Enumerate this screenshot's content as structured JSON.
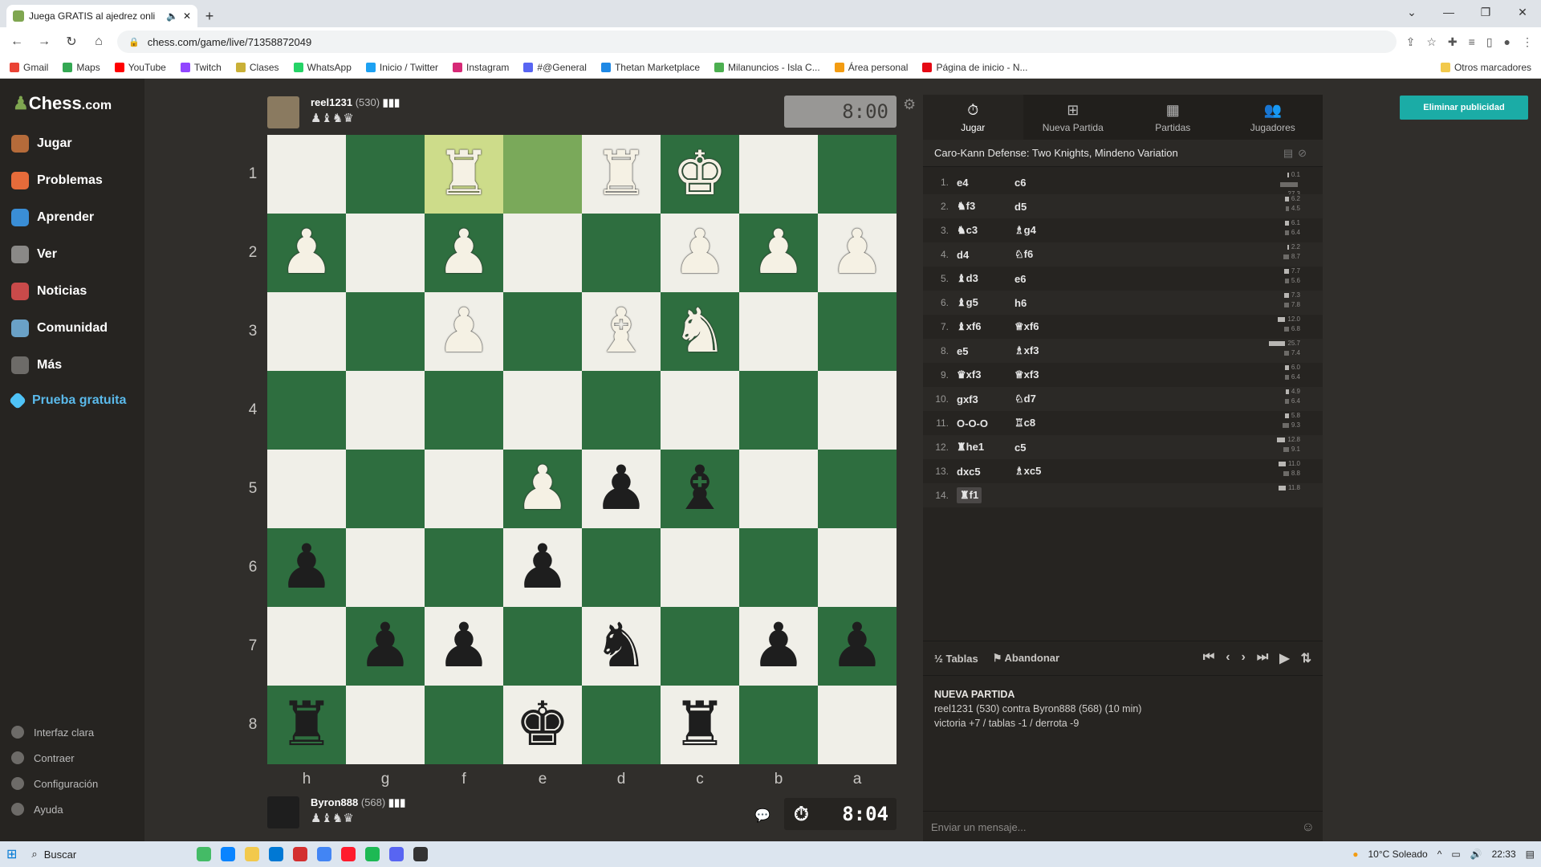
{
  "browser": {
    "tab_title": "Juega GRATIS al ajedrez onli",
    "url": "chess.com/game/live/71358872049",
    "bookmarks": [
      "Gmail",
      "Maps",
      "YouTube",
      "Twitch",
      "Clases",
      "WhatsApp",
      "Inicio / Twitter",
      "Instagram",
      "#@General",
      "Thetan Marketplace",
      "Milanuncios - Isla C...",
      "Área personal",
      "Página de inicio - N..."
    ],
    "bookmarks_other": "Otros marcadores"
  },
  "leftnav": {
    "logo": "Chess",
    "logo_suffix": ".com",
    "items": [
      "Jugar",
      "Problemas",
      "Aprender",
      "Ver",
      "Noticias",
      "Comunidad",
      "Más",
      "Prueba gratuita"
    ],
    "bottom": [
      "Interfaz clara",
      "Contraer",
      "Configuración",
      "Ayuda"
    ]
  },
  "top_player": {
    "name": "reel1231",
    "rating": "(530)",
    "captured": "♟♝♞♛",
    "clock": "8:00"
  },
  "bottom_player": {
    "name": "Byron888",
    "rating": "(568)",
    "captured": "♟♝♞♛",
    "clock": "8:04"
  },
  "board": {
    "ranks": [
      "1",
      "2",
      "3",
      "4",
      "5",
      "6",
      "7",
      "8"
    ],
    "files": [
      "h",
      "g",
      "f",
      "e",
      "d",
      "c",
      "b",
      "a"
    ],
    "rows": [
      [
        "",
        "",
        "wR",
        "",
        "wR",
        "wK",
        "",
        ""
      ],
      [
        "wP",
        "",
        "wP",
        "",
        "",
        "wP",
        "wP",
        "wP"
      ],
      [
        "",
        "",
        "wP",
        "",
        "wB",
        "wN",
        "",
        ""
      ],
      [
        "",
        "",
        "",
        "",
        "",
        "",
        "",
        ""
      ],
      [
        "",
        "",
        "",
        "wP",
        "bP",
        "bB",
        "",
        ""
      ],
      [
        "bP",
        "",
        "",
        "bP",
        "",
        "",
        "",
        ""
      ],
      [
        "",
        "bP",
        "bP",
        "",
        "bN",
        "",
        "bP",
        "bP"
      ],
      [
        "bR",
        "",
        "",
        "bK",
        "",
        "bR",
        "",
        ""
      ]
    ]
  },
  "rpanel": {
    "tabs": [
      "Jugar",
      "Nueva Partida",
      "Partidas",
      "Jugadores"
    ],
    "opening": "Caro-Kann Defense: Two Knights, Mindeno Variation",
    "moves": [
      {
        "n": "1.",
        "w": "e4",
        "b": "c6",
        "tw": "0.1",
        "tb": "27.3"
      },
      {
        "n": "2.",
        "w": "♞f3",
        "b": "d5",
        "tw": "6.2",
        "tb": "4.5"
      },
      {
        "n": "3.",
        "w": "♞c3",
        "b": "♗g4",
        "tw": "6.1",
        "tb": "6.4"
      },
      {
        "n": "4.",
        "w": "d4",
        "b": "♘f6",
        "tw": "2.2",
        "tb": "8.7"
      },
      {
        "n": "5.",
        "w": "♝d3",
        "b": "e6",
        "tw": "7.7",
        "tb": "5.6"
      },
      {
        "n": "6.",
        "w": "♝g5",
        "b": "h6",
        "tw": "7.3",
        "tb": "7.8"
      },
      {
        "n": "7.",
        "w": "♝xf6",
        "b": "♕xf6",
        "tw": "12.0",
        "tb": "6.8"
      },
      {
        "n": "8.",
        "w": "e5",
        "b": "♗xf3",
        "tw": "25.7",
        "tb": "7.4"
      },
      {
        "n": "9.",
        "w": "♛xf3",
        "b": "♕xf3",
        "tw": "6.0",
        "tb": "6.4"
      },
      {
        "n": "10.",
        "w": "gxf3",
        "b": "♘d7",
        "tw": "4.9",
        "tb": "6.4"
      },
      {
        "n": "11.",
        "w": "O-O-O",
        "b": "♖c8",
        "tw": "5.8",
        "tb": "9.3"
      },
      {
        "n": "12.",
        "w": "♜he1",
        "b": "c5",
        "tw": "12.8",
        "tb": "9.1"
      },
      {
        "n": "13.",
        "w": "dxc5",
        "b": "♗xc5",
        "tw": "11.0",
        "tb": "8.8"
      },
      {
        "n": "14.",
        "w": "♜f1",
        "b": "",
        "tw": "11.8",
        "tb": ""
      }
    ],
    "draw": "Tablas",
    "resign": "Abandonar",
    "newgame_title": "NUEVA PARTIDA",
    "newgame_line1": "reel1231 (530) contra Byron888 (568) (10 min)",
    "newgame_line2": "victoria +7 / tablas -1 / derrota -9",
    "chat_placeholder": "Enviar un mensaje..."
  },
  "ad_button": "Eliminar publicidad",
  "taskbar": {
    "search": "Buscar",
    "weather": "10°C  Soleado",
    "time": "22:33"
  }
}
